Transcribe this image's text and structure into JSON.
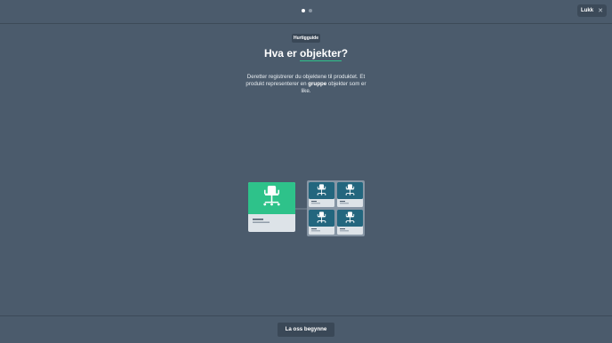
{
  "pagination": {
    "total": 2,
    "active_index": 0
  },
  "close_button": {
    "label": "Lukk",
    "icon": "close-icon"
  },
  "badge": {
    "label": "Hurtigguide"
  },
  "heading": {
    "prefix": "Hva er ",
    "highlight": "objekter",
    "suffix": "?"
  },
  "description": {
    "part1": "Deretter registrerer du objektene til produktet. Et produkt representerer en ",
    "bold": "gruppe",
    "part2": " objekter som er like."
  },
  "illustration": {
    "product_icon": "office-chair-icon",
    "object_icon": "office-chair-icon",
    "object_count": 4
  },
  "colors": {
    "background": "#4b5b6c",
    "accent_green": "#2ec28a",
    "accent_teal": "#23667e"
  },
  "start_button": {
    "label": "La oss begynne"
  }
}
